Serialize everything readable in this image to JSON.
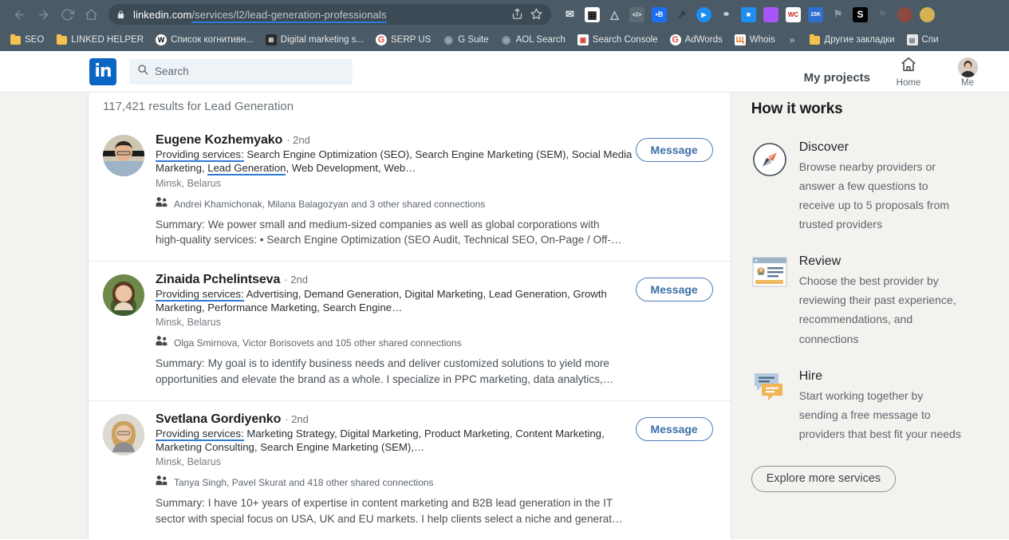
{
  "browser": {
    "nav": {
      "back": "back-arrow",
      "forward": "forward-arrow",
      "reload": "reload",
      "home": "home"
    },
    "url": {
      "host": "linkedin.com",
      "path1": "/services/l2/",
      "path2": "lead-generation-professionals",
      "lock_icon": "lock-icon"
    },
    "omnibox_icons": [
      "share-icon",
      "bookmark-star-icon"
    ],
    "extensions": [
      {
        "name": "ext-mail-stack",
        "glyph": "✉",
        "bg": "transparent",
        "fg": "#e8eaed"
      },
      {
        "name": "ext-qr-code",
        "glyph": "▒",
        "bg": "#ffffff",
        "fg": "#1a1a1a"
      },
      {
        "name": "ext-shield",
        "glyph": "▽",
        "bg": "transparent",
        "fg": "#c6ced4"
      },
      {
        "name": "ext-code",
        "glyph": "</>",
        "bg": "#5d6c77",
        "fg": "#eef1f3"
      },
      {
        "name": "ext-blue-tag",
        "glyph": "B",
        "bg": "#1d6ff2",
        "fg": "#ffffff"
      },
      {
        "name": "ext-scooter",
        "glyph": "⤳",
        "bg": "transparent",
        "fg": "#2c3a45"
      },
      {
        "name": "ext-play-circle",
        "glyph": "▶",
        "bg": "#1f8ef1",
        "fg": "#ffffff"
      },
      {
        "name": "ext-link-chain",
        "glyph": "⚭",
        "bg": "transparent",
        "fg": "#cfd6db"
      },
      {
        "name": "ext-video-camera",
        "glyph": "■",
        "bg": "#1f8ef1",
        "fg": "#ffffff"
      },
      {
        "name": "ext-purple-square",
        "glyph": "",
        "bg": "#a855f7",
        "fg": "#ffffff"
      },
      {
        "name": "ext-wc",
        "glyph": "WC",
        "bg": "#ffffff",
        "fg": "#cc2222"
      },
      {
        "name": "ext-15k",
        "glyph": "15K",
        "bg": "#2f6fd0",
        "fg": "#ffffff"
      },
      {
        "name": "ext-gray-pin",
        "glyph": "⚑",
        "bg": "transparent",
        "fg": "#8b979f"
      },
      {
        "name": "ext-s-badge",
        "glyph": "S",
        "bg": "#000000",
        "fg": "#ffffff"
      },
      {
        "name": "ext-faded-pin",
        "glyph": "⚑",
        "bg": "transparent",
        "fg": "#5e6d78"
      },
      {
        "name": "ext-avatar-red",
        "glyph": "",
        "bg": "#8d4a3e",
        "fg": "#ffffff"
      },
      {
        "name": "ext-avatar-gold",
        "glyph": "",
        "bg": "#d4b251",
        "fg": "#ffffff"
      }
    ],
    "bookmarks": [
      {
        "label": "SEO",
        "icon": "folder-icon"
      },
      {
        "label": "LINKED HELPER",
        "icon": "folder-icon"
      },
      {
        "label": "Список когнитивн...",
        "icon": "wikipedia-icon",
        "glyph": "W",
        "bg": "#ffffff",
        "fg": "#000000"
      },
      {
        "label": "Digital marketing s...",
        "icon": "news-icon",
        "glyph": "▤",
        "bg": "#2b2b2b",
        "fg": "#ffffff"
      },
      {
        "label": "SERP US",
        "icon": "google-icon",
        "glyph": "G",
        "bg": "transparent",
        "fg": "#e24b39"
      },
      {
        "label": "G Suite",
        "icon": "globe-icon",
        "glyph": "●",
        "bg": "transparent",
        "fg": "#9aa6ad"
      },
      {
        "label": "AOL Search",
        "icon": "globe-icon",
        "glyph": "●",
        "bg": "transparent",
        "fg": "#9aa6ad"
      },
      {
        "label": "Search Console",
        "icon": "search-console-icon",
        "glyph": "▣",
        "bg": "#ffffff",
        "fg": "#d44338"
      },
      {
        "label": "AdWords",
        "icon": "google-icon",
        "glyph": "G",
        "bg": "transparent",
        "fg": "#e24b39"
      },
      {
        "label": "Whois",
        "icon": "whois-icon",
        "glyph": "Щ",
        "bg": "#ffffff",
        "fg": "#e8761f"
      },
      {
        "label": "»",
        "icon": "overflow-chevron-icon"
      },
      {
        "label": "Другие закладки",
        "icon": "folder-icon"
      },
      {
        "label": "Спи",
        "icon": "notes-icon",
        "glyph": "▤",
        "bg": "#e4e6e8",
        "fg": "#6b737a"
      }
    ]
  },
  "header": {
    "logo": "in",
    "search_placeholder": "Search",
    "search_value": "",
    "my_projects": "My projects",
    "home_label": "Home",
    "me_label": "Me"
  },
  "main": {
    "results_count": "117,421 results for Lead Generation",
    "message_button": "Message",
    "providing_services_label": "Providing services:",
    "profiles": [
      {
        "name": "Eugene Kozhemyako",
        "degree": "· 2nd",
        "services_pre": " Search Engine Optimization (SEO), Search Engine Marketing (SEM), Social Media Marketing, ",
        "services_highlight": "Lead Generation",
        "services_post": ", Web Development, Web…",
        "location": "Minsk, Belarus",
        "connections": "Andrei Khamichonak, Milana Balagozyan and 3 other shared connections",
        "summary": "Summary: We power small and medium-sized companies as well as global corporations with high-quality services: • Search Engine Optimization (SEO Audit, Technical SEO, On-Page / Off-…",
        "avatar_skin": "#e3b48f",
        "avatar_hair": "#2e2620",
        "avatar_shirt": "#9fb3c6",
        "avatar_bg": "#cfc7b4"
      },
      {
        "name": "Zinaida Pchelintseva",
        "degree": "· 2nd",
        "services_pre": " Advertising, Demand Generation, Digital Marketing, Lead Generation, Growth Marketing, Performance Marketing, Search Engine…",
        "services_highlight": "",
        "services_post": "",
        "location": "Minsk, Belarus",
        "connections": "Olga Smirnova, Victor Borisovets and 105 other shared connections",
        "summary": "Summary: My goal is to identify business needs and deliver customized solutions to yield more opportunities and elevate the brand as a whole. I specialize in PPC marketing, data analytics,…",
        "avatar_skin": "#edc3a5",
        "avatar_hair": "#5a3a22",
        "avatar_shirt": "#6e8f4e",
        "avatar_bg": "#6d8a4a"
      },
      {
        "name": "Svetlana Gordiyenko",
        "degree": "· 2nd",
        "services_pre": " Marketing Strategy, Digital Marketing, Product Marketing, Content Marketing, Marketing Consulting, Search Engine Marketing (SEM),…",
        "services_highlight": "",
        "services_post": "",
        "location": "Minsk, Belarus",
        "connections": "Tanya Singh, Pavel Skurat and 418 other shared connections",
        "summary": "Summary: I have 10+ years of expertise in content marketing and B2B lead generation in the IT sector with special focus on USA, UK and EU markets. I help clients select a niche and generat…",
        "avatar_skin": "#eec5a6",
        "avatar_hair": "#caa25f",
        "avatar_shirt": "#8d8d93",
        "avatar_bg": "#dcd8d2"
      }
    ]
  },
  "sidebar": {
    "title": "How it works",
    "steps": [
      {
        "icon": "compass-icon",
        "title": "Discover",
        "description": "Browse nearby providers or answer a few questions to receive up to 5 proposals from trusted providers"
      },
      {
        "icon": "review-card-icon",
        "title": "Review",
        "description": "Choose the best provider by reviewing their past experience, recommendations, and connections"
      },
      {
        "icon": "chat-bubbles-icon",
        "title": "Hire",
        "description": "Start working together by sending a free message to providers that best fit your needs"
      }
    ],
    "explore_button": "Explore more services"
  },
  "colors": {
    "linkedin_blue": "#0a66c2",
    "underline_blue": "#2f7bd6",
    "chrome_bg": "#4a5a66",
    "page_bg": "#f3f2ef"
  }
}
